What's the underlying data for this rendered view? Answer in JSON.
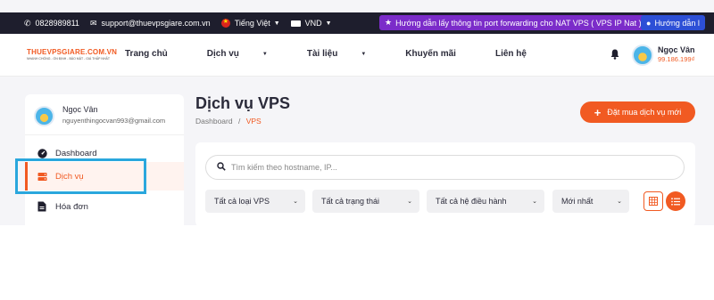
{
  "topbar": {
    "phone": "0828989811",
    "email": "support@thuevpsgiare.com.vn",
    "language": "Tiếng Việt",
    "currency": "VND",
    "announcement": "Hướng dẫn lấy thông tin port forwarding cho NAT VPS ( VPS IP Nat )",
    "announcement_2": "Hướng dẫn l"
  },
  "nav": {
    "logo_text": "THUEVPSGIARE.COM.VN",
    "logo_tagline": "NHANH CHÓNG - ỔN ĐỊNH - BẢO MẬT - GIÁ THẤP NHẤT",
    "items": [
      {
        "label": "Trang chủ",
        "dropdown": false
      },
      {
        "label": "Dịch vụ",
        "dropdown": true
      },
      {
        "label": "Tài liệu",
        "dropdown": true
      },
      {
        "label": "Khuyến mãi",
        "dropdown": false
      },
      {
        "label": "Liên hệ",
        "dropdown": false
      }
    ],
    "user_name": "Ngọc Vân",
    "user_balance": "99.186.199₫"
  },
  "sidebar": {
    "profile_name": "Ngọc Vân",
    "profile_email": "nguyenthingocvan993@gmail.com",
    "items": [
      {
        "label": "Dashboard",
        "icon": "dashboard-icon"
      },
      {
        "label": "Dịch vụ",
        "icon": "server-icon",
        "active": true
      },
      {
        "label": "Hóa đơn",
        "icon": "invoice-icon"
      }
    ]
  },
  "main": {
    "title": "Dịch vụ VPS",
    "breadcrumb": [
      "Dashboard",
      "VPS"
    ],
    "breadcrumb_sep": "/",
    "order_button": "Đặt mua dịch vụ mới",
    "search_placeholder": "Tìm kiếm theo hostname, IP...",
    "filters": [
      "Tất cả loại VPS",
      "Tất cả trạng thái",
      "Tất cả hệ điều hành",
      "Mới nhất"
    ],
    "view_modes": [
      "grid-view",
      "list-view"
    ],
    "active_view": "list-view"
  },
  "colors": {
    "accent": "#f15a22",
    "topbar_bg": "#1e1e2d",
    "announce_bg": "#7b2cc9",
    "highlight_box": "#2aa7dd"
  }
}
